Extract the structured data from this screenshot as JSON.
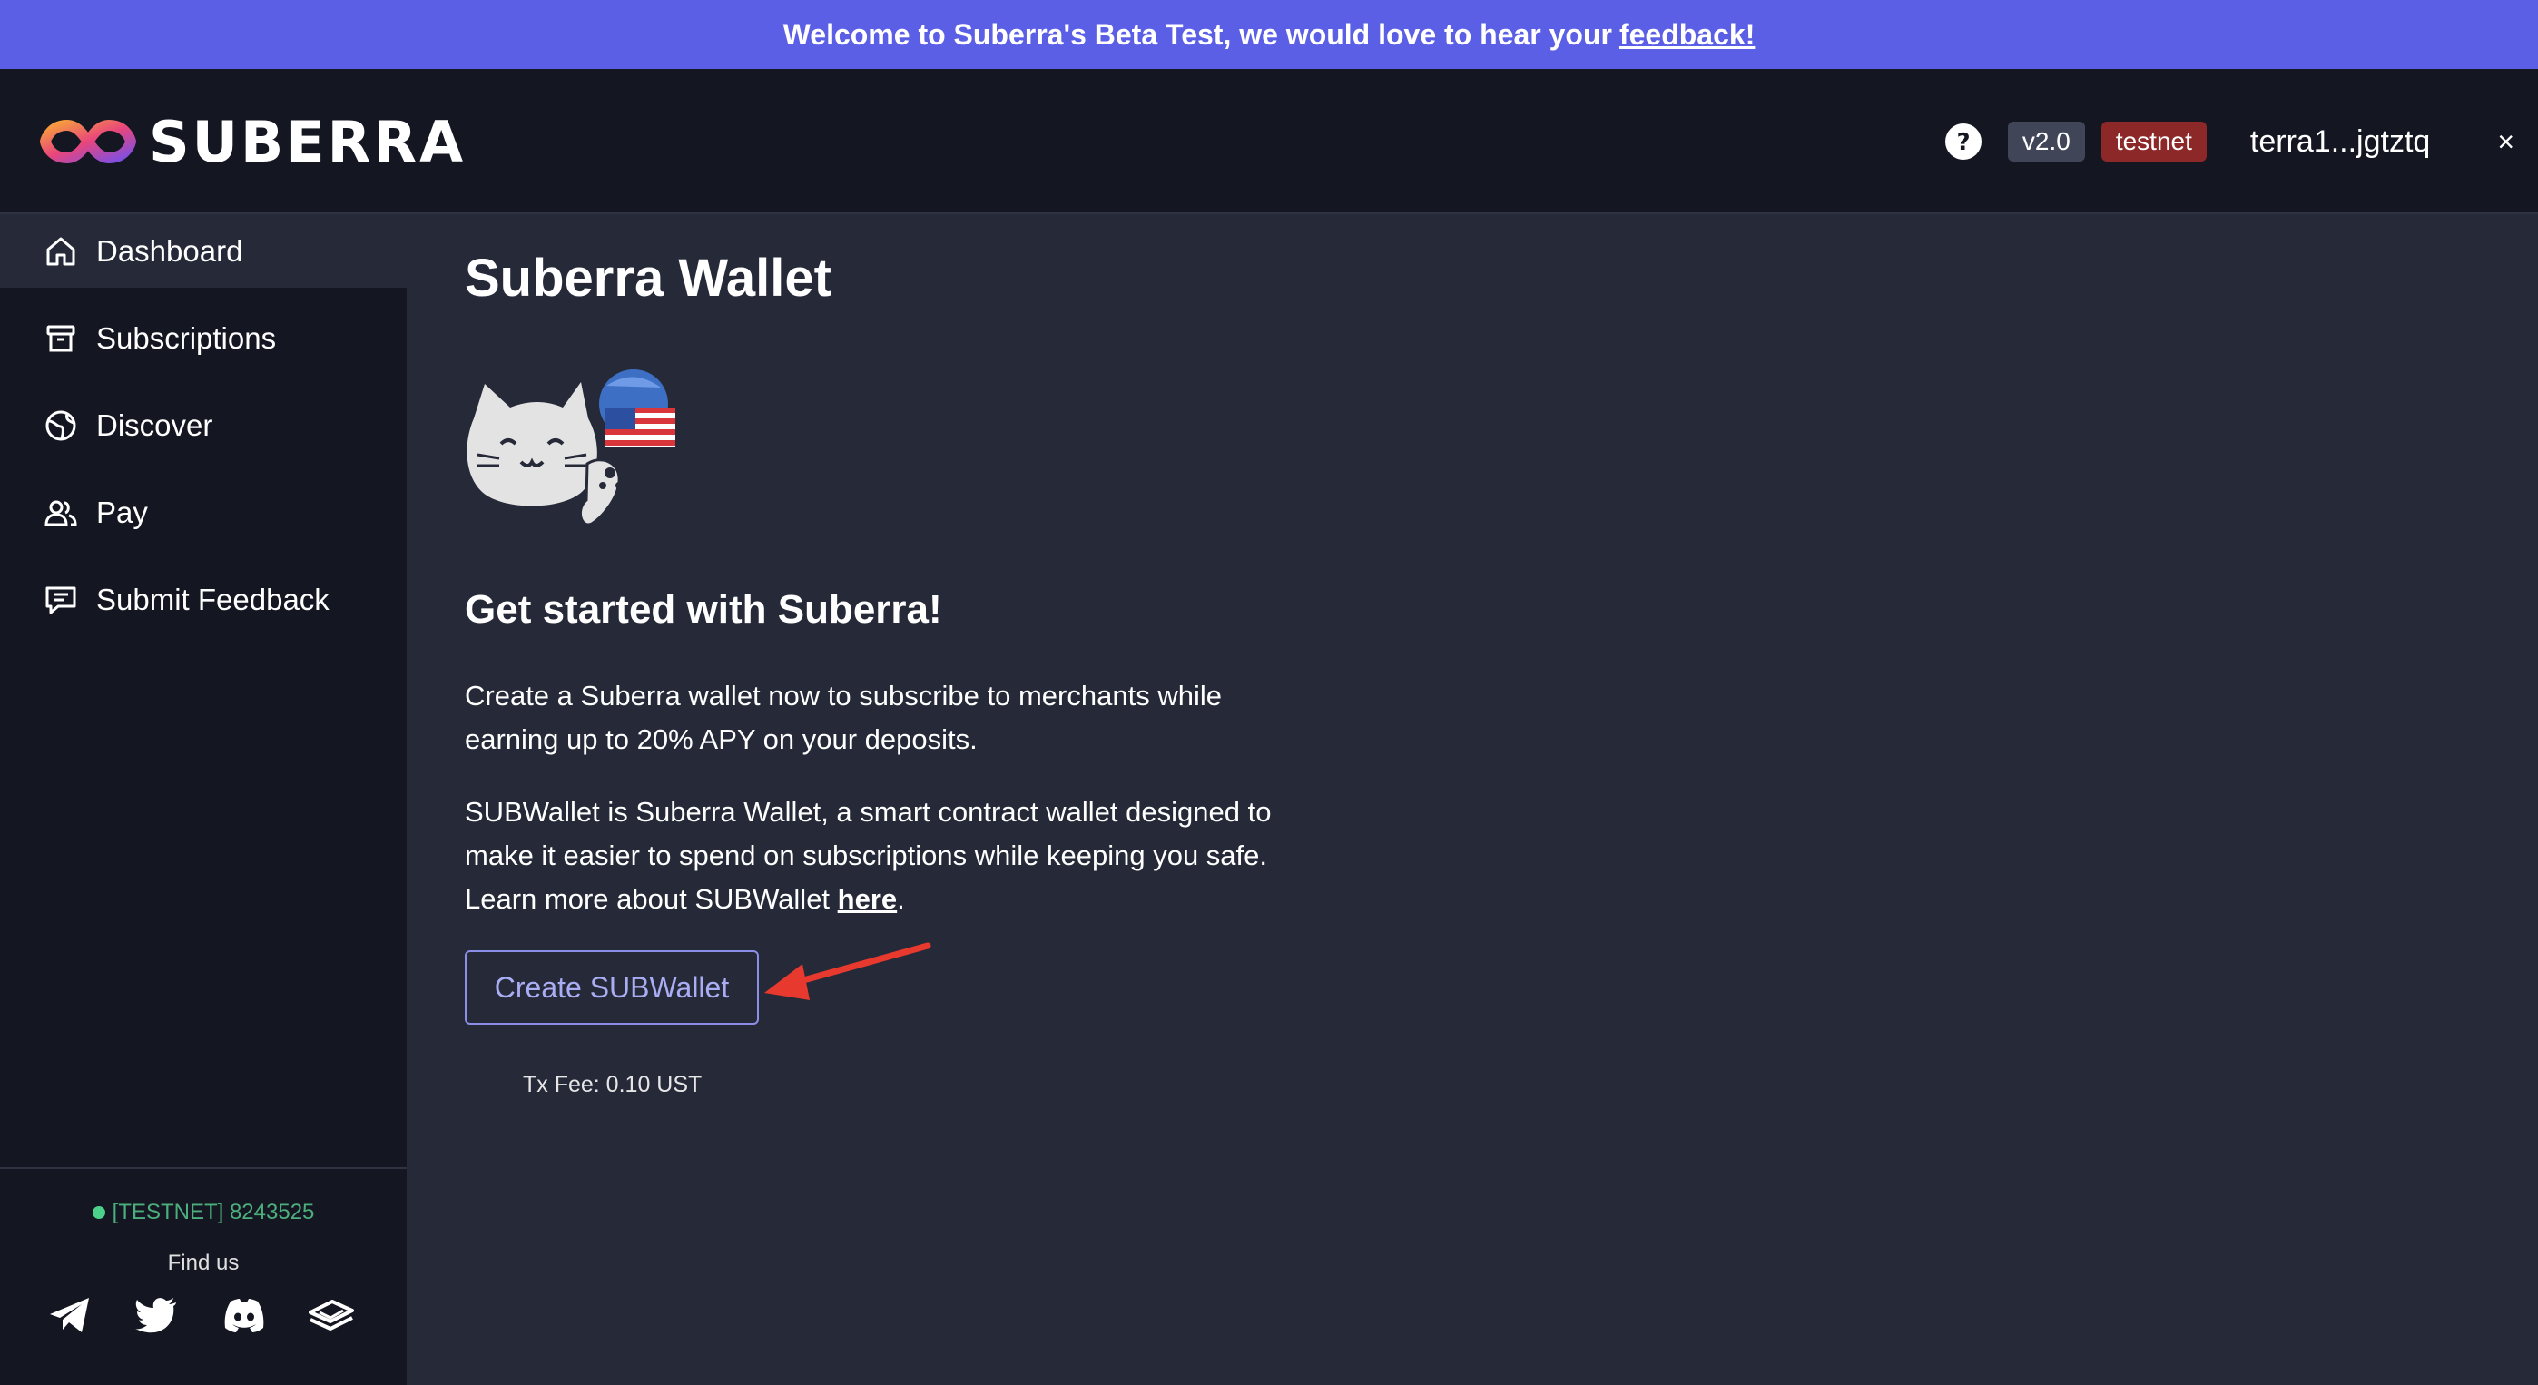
{
  "banner": {
    "text": "Welcome to Suberra's Beta Test, we would love to hear your",
    "link": "feedback!"
  },
  "header": {
    "logo_text": "SUBERRA",
    "version": "v2.0",
    "network": "testnet",
    "wallet_address": "terra1...jgtztq",
    "close_label": "×",
    "help_icon": "help-circle-icon"
  },
  "sidebar": {
    "items": [
      {
        "label": "Dashboard",
        "icon": "home-icon"
      },
      {
        "label": "Subscriptions",
        "icon": "archive-icon"
      },
      {
        "label": "Discover",
        "icon": "globe-icon"
      },
      {
        "label": "Pay",
        "icon": "users-icon"
      },
      {
        "label": "Submit Feedback",
        "icon": "feedback-icon"
      }
    ],
    "active_index": 0,
    "network_status": "[TESTNET] 8243525",
    "find_us": "Find us",
    "socials": [
      "telegram-icon",
      "twitter-icon",
      "discord-icon",
      "docs-icon"
    ]
  },
  "main": {
    "title": "Suberra Wallet",
    "heading": "Get started with Suberra!",
    "para1": "Create a Suberra wallet now to subscribe to merchants while earning up to 20% APY on your deposits.",
    "para2_text": "SUBWallet is Suberra Wallet, a smart contract wallet designed to make it easier to spend on subscriptions while keeping you safe. Learn more about SUBWallet",
    "para2_link": "here",
    "para2_end": ".",
    "create_button": "Create SUBWallet",
    "tx_fee": "Tx Fee: 0.10 UST"
  },
  "colors": {
    "banner": "#5b5fe6",
    "header_bg": "#141621",
    "main_bg": "#262a38",
    "accent": "#a9adf4",
    "testnet_badge": "#8c2828",
    "status_green": "#4cae7c",
    "annotation_arrow": "#e8392e"
  }
}
